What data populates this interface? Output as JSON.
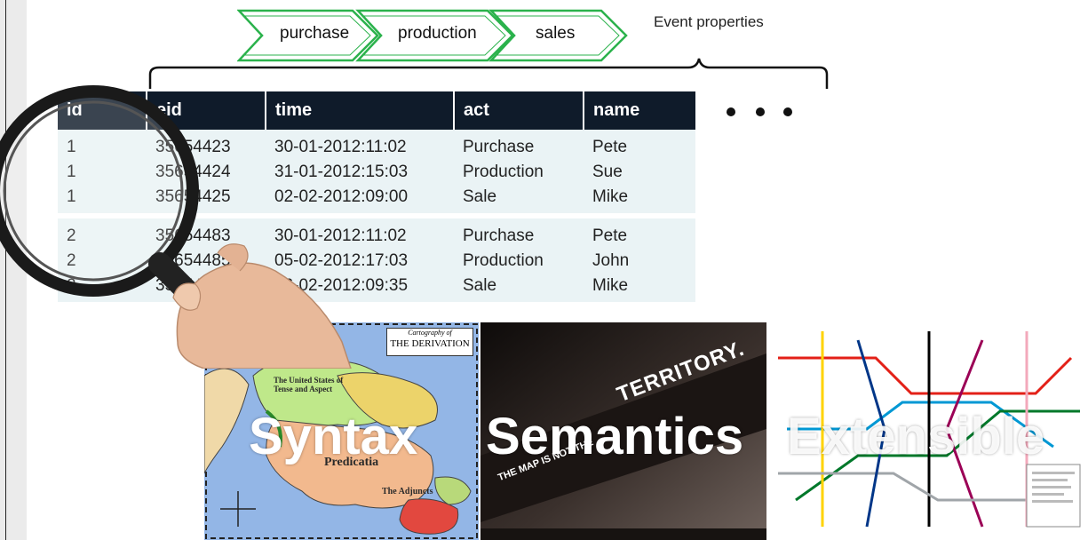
{
  "process_steps": [
    "purchase",
    "production",
    "sales"
  ],
  "event_properties_label": "Event properties",
  "table": {
    "columns": [
      "id",
      "eid",
      "time",
      "act",
      "name"
    ],
    "groups": [
      [
        [
          "1",
          "35654423",
          "30-01-2012:11:02",
          "Purchase",
          "Pete"
        ],
        [
          "1",
          "35654424",
          "31-01-2012:15:03",
          "Production",
          "Sue"
        ],
        [
          "1",
          "35654425",
          "02-02-2012:09:00",
          "Sale",
          "Mike"
        ]
      ],
      [
        [
          "2",
          "35654483",
          "30-01-2012:11:02",
          "Purchase",
          "Pete"
        ],
        [
          "2",
          "35654485",
          "05-02-2012:17:03",
          "Production",
          "John"
        ],
        [
          "2",
          "35654487",
          "06-02-2012:09:35",
          "Sale",
          "Mike"
        ]
      ]
    ]
  },
  "more_columns_indicator": "ellipsis-dots",
  "panels": {
    "syntax": {
      "word": "Syntax",
      "map_title_sub": "Cartography of",
      "map_title": "THE DERIVATION",
      "labels": [
        "The United States of Tense and Aspect",
        "Predicatia",
        "The Adjuncts"
      ]
    },
    "semantics": {
      "word": "Semantics",
      "banner_text": "TERRITORY.",
      "banner_small": "THE MAP IS NOT THE"
    },
    "extensible": {
      "word": "Extensible"
    }
  },
  "icons": [
    "magnifying-glass-icon",
    "hand-icon"
  ],
  "colors": {
    "chevron_border": "#2bb24c",
    "table_header": "#0f1b2a",
    "table_body": "#eaf3f5",
    "map_water": "#93b6e6",
    "semantics_bg": "#2b2422"
  }
}
